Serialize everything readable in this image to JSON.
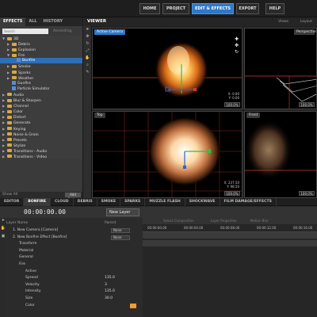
{
  "top_menu": [
    "HOME",
    "PROJECT",
    "EDIT & EFFECTS",
    "EXPORT",
    "HELP"
  ],
  "left_tabs": [
    "EFFECTS",
    "ALL",
    "HISTORY"
  ],
  "search": {
    "placeholder": "Search",
    "sort_label": "Ascending"
  },
  "effects_tree": [
    {
      "label": "3D",
      "level": 0,
      "kind": "folder",
      "expanded": true
    },
    {
      "label": "Debris",
      "level": 1,
      "kind": "folder"
    },
    {
      "label": "Explosion",
      "level": 1,
      "kind": "folder"
    },
    {
      "label": "Fire",
      "level": 1,
      "kind": "folder",
      "expanded": true
    },
    {
      "label": "Bonfire",
      "level": 2,
      "kind": "effect",
      "selected": true
    },
    {
      "label": "Smoke",
      "level": 1,
      "kind": "folder"
    },
    {
      "label": "Sparks",
      "level": 1,
      "kind": "folder"
    },
    {
      "label": "Weather",
      "level": 1,
      "kind": "folder"
    },
    {
      "label": "Gunfire",
      "level": 1,
      "kind": "effect"
    },
    {
      "label": "Particle Simulator",
      "level": 1,
      "kind": "effect"
    },
    {
      "label": "Audio",
      "level": 0,
      "kind": "folder"
    },
    {
      "label": "Blur & Sharpen",
      "level": 0,
      "kind": "folder"
    },
    {
      "label": "Channel",
      "level": 0,
      "kind": "folder"
    },
    {
      "label": "Color",
      "level": 0,
      "kind": "folder"
    },
    {
      "label": "Distort",
      "level": 0,
      "kind": "folder"
    },
    {
      "label": "Generate",
      "level": 0,
      "kind": "folder"
    },
    {
      "label": "Keying",
      "level": 0,
      "kind": "folder"
    },
    {
      "label": "Noise & Grain",
      "level": 0,
      "kind": "folder"
    },
    {
      "label": "Presets",
      "level": 0,
      "kind": "folder"
    },
    {
      "label": "Stylize",
      "level": 0,
      "kind": "folder"
    },
    {
      "label": "Transitions - Audio",
      "level": 0,
      "kind": "folder"
    },
    {
      "label": "Transitions - Video",
      "level": 0,
      "kind": "folder"
    }
  ],
  "left_bottom": {
    "show": "Show All",
    "button": "Add Folder"
  },
  "viewer": {
    "title": "VIEWER",
    "views": "Views",
    "layout": "Layout"
  },
  "panes": {
    "active_camera": "Active Camera",
    "perspective": "Perspective",
    "top": "Top",
    "front": "Front",
    "readout_main": [
      "X:",
      "Y:",
      "Z:",
      "0.00",
      "0.00"
    ],
    "readout_top": [
      "X:",
      "Y:",
      "237.50",
      "98.50"
    ],
    "zoom": "100.0%"
  },
  "bottom_tabs": [
    "EDITOR",
    "BONFIRE",
    "CLOUD",
    "DEBRIS",
    "SMOKE",
    "SPARKS",
    "MUZZLE FLASH",
    "SHOCKWAVE",
    "FILM DAMAGE/EFFECTS"
  ],
  "timecode": "00:00:00.00",
  "new_layer": "New Layer",
  "layer_header": {
    "name": "Layer Name",
    "parent": "Parent"
  },
  "layers": [
    {
      "label": "1. New Camera [Camera]",
      "indent": 1,
      "parent": "None"
    },
    {
      "label": "2. New Bonfire Effect [Bonfire]",
      "indent": 1,
      "parent": "None"
    },
    {
      "label": "Transform",
      "indent": 2
    },
    {
      "label": "Material",
      "indent": 2
    },
    {
      "label": "General",
      "indent": 2
    },
    {
      "label": "Fire",
      "indent": 2
    },
    {
      "label": "Active",
      "indent": 3
    },
    {
      "label": "Spread",
      "indent": 3,
      "value": "135.0"
    },
    {
      "label": "Velocity",
      "indent": 3,
      "value": "3"
    },
    {
      "label": "Intensity",
      "indent": 3,
      "value": "135.0"
    },
    {
      "label": "Size",
      "indent": 3,
      "value": "30.0"
    },
    {
      "label": "Color",
      "indent": 3
    }
  ],
  "timeline_header": [
    "Select Composition",
    "Layer Properties",
    "Motion Blur"
  ],
  "timeline_ticks": [
    "00:00:00.00",
    "00:00:04.00",
    "00:00:08.00",
    "00:00:12.00",
    "00:00:16.00"
  ],
  "colors": {
    "accent": "#2f78c8",
    "fire": "#ff9a2a",
    "grid": "#c8402f"
  }
}
